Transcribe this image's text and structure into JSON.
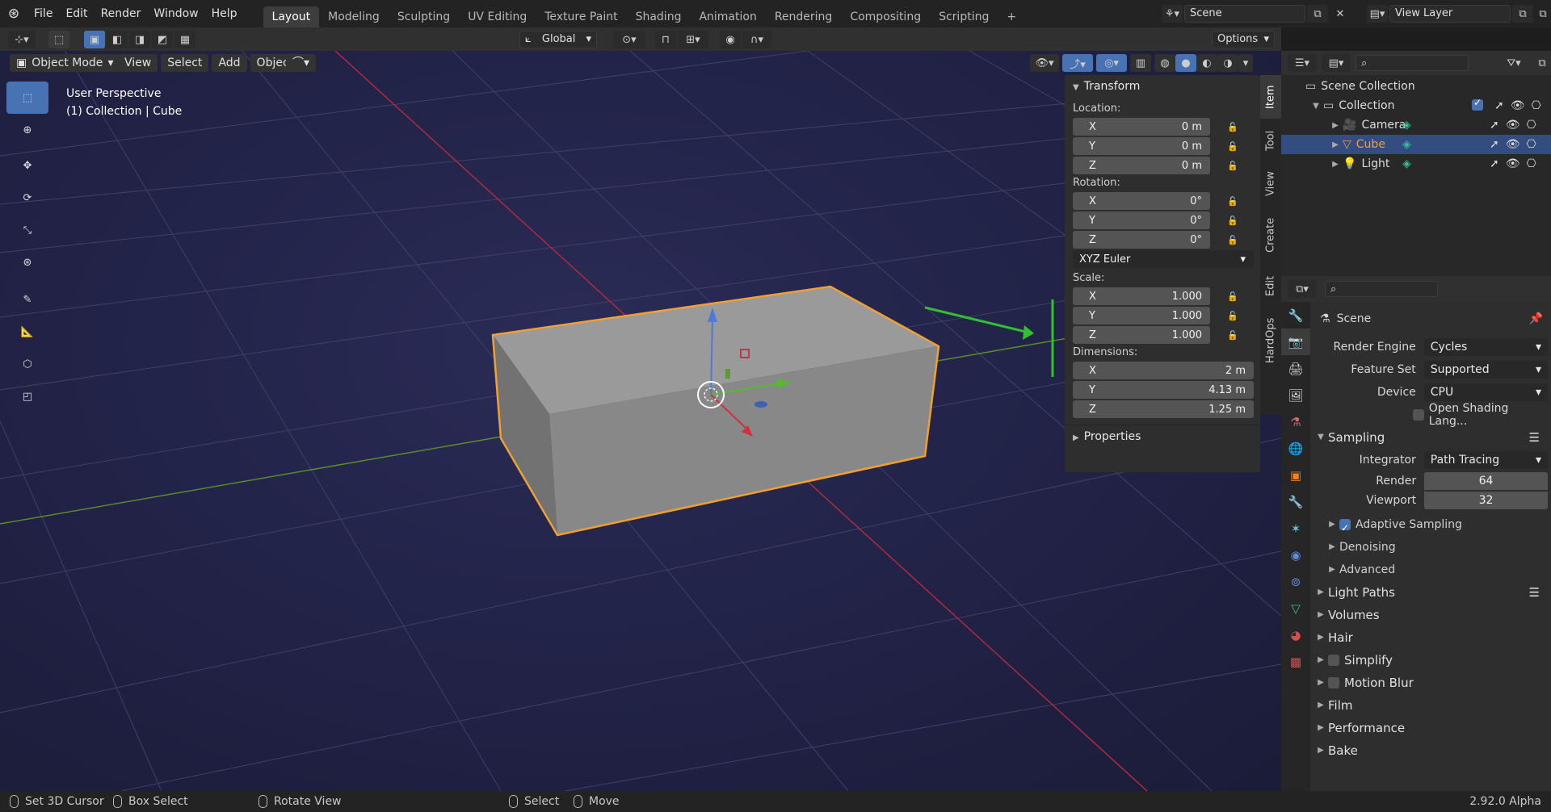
{
  "menu": {
    "items": [
      "File",
      "Edit",
      "Render",
      "Window",
      "Help"
    ]
  },
  "workspaces": {
    "tabs": [
      "Layout",
      "Modeling",
      "Sculpting",
      "UV Editing",
      "Texture Paint",
      "Shading",
      "Animation",
      "Rendering",
      "Compositing",
      "Scripting"
    ],
    "active": "Layout",
    "add_symbol": "+"
  },
  "scene": {
    "label": "Scene",
    "view_layer": "View Layer"
  },
  "tool_header": {
    "orientation": "Global",
    "options": "Options"
  },
  "view_header": {
    "mode": "Object Mode",
    "menus": [
      "View",
      "Select",
      "Add",
      "Object"
    ]
  },
  "viewport": {
    "perspective": "User Perspective",
    "context": "(1) Collection | Cube"
  },
  "npanel": {
    "transform_title": "Transform",
    "location_label": "Location:",
    "location": [
      {
        "axis": "X",
        "value": "0 m"
      },
      {
        "axis": "Y",
        "value": "0 m"
      },
      {
        "axis": "Z",
        "value": "0 m"
      }
    ],
    "rotation_label": "Rotation:",
    "rotation": [
      {
        "axis": "X",
        "value": "0°"
      },
      {
        "axis": "Y",
        "value": "0°"
      },
      {
        "axis": "Z",
        "value": "0°"
      }
    ],
    "rotation_mode": "XYZ Euler",
    "scale_label": "Scale:",
    "scale": [
      {
        "axis": "X",
        "value": "1.000"
      },
      {
        "axis": "Y",
        "value": "1.000"
      },
      {
        "axis": "Z",
        "value": "1.000"
      }
    ],
    "dimensions_label": "Dimensions:",
    "dimensions": [
      {
        "axis": "X",
        "value": "2 m"
      },
      {
        "axis": "Y",
        "value": "4.13 m"
      },
      {
        "axis": "Z",
        "value": "1.25 m"
      }
    ],
    "properties_title": "Properties",
    "tabs": [
      "Item",
      "Tool",
      "View",
      "Create",
      "Edit",
      "HardOps"
    ],
    "active_tab": "Item"
  },
  "outliner": {
    "root": "Scene Collection",
    "collection": "Collection",
    "items": [
      {
        "name": "Camera",
        "color": "#e08a36"
      },
      {
        "name": "Cube",
        "color": "#e8a040",
        "selected": true
      },
      {
        "name": "Light",
        "color": "#e08a36"
      }
    ]
  },
  "properties": {
    "context": "Scene",
    "render_engine_label": "Render Engine",
    "render_engine": "Cycles",
    "feature_set_label": "Feature Set",
    "feature_set": "Supported",
    "device_label": "Device",
    "device": "CPU",
    "osl": "Open Shading Lang...",
    "sampling": "Sampling",
    "integrator_label": "Integrator",
    "integrator": "Path Tracing",
    "render_label": "Render",
    "render_samples": "64",
    "viewport_label": "Viewport",
    "viewport_samples": "32",
    "adaptive": "Adaptive Sampling",
    "denoising": "Denoising",
    "advanced": "Advanced",
    "light_paths": "Light Paths",
    "volumes": "Volumes",
    "hair": "Hair",
    "simplify": "Simplify",
    "motion_blur": "Motion Blur",
    "film": "Film",
    "performance": "Performance",
    "bake": "Bake"
  },
  "status": {
    "set_cursor": "Set 3D Cursor",
    "box_select": "Box Select",
    "rotate_view": "Rotate View",
    "select": "Select",
    "move": "Move",
    "version": "2.92.0 Alpha"
  },
  "colors": {
    "accent": "#4772b3",
    "selection_outline": "#f0a030",
    "x_axis": "#c03040",
    "y_axis": "#70a030"
  }
}
